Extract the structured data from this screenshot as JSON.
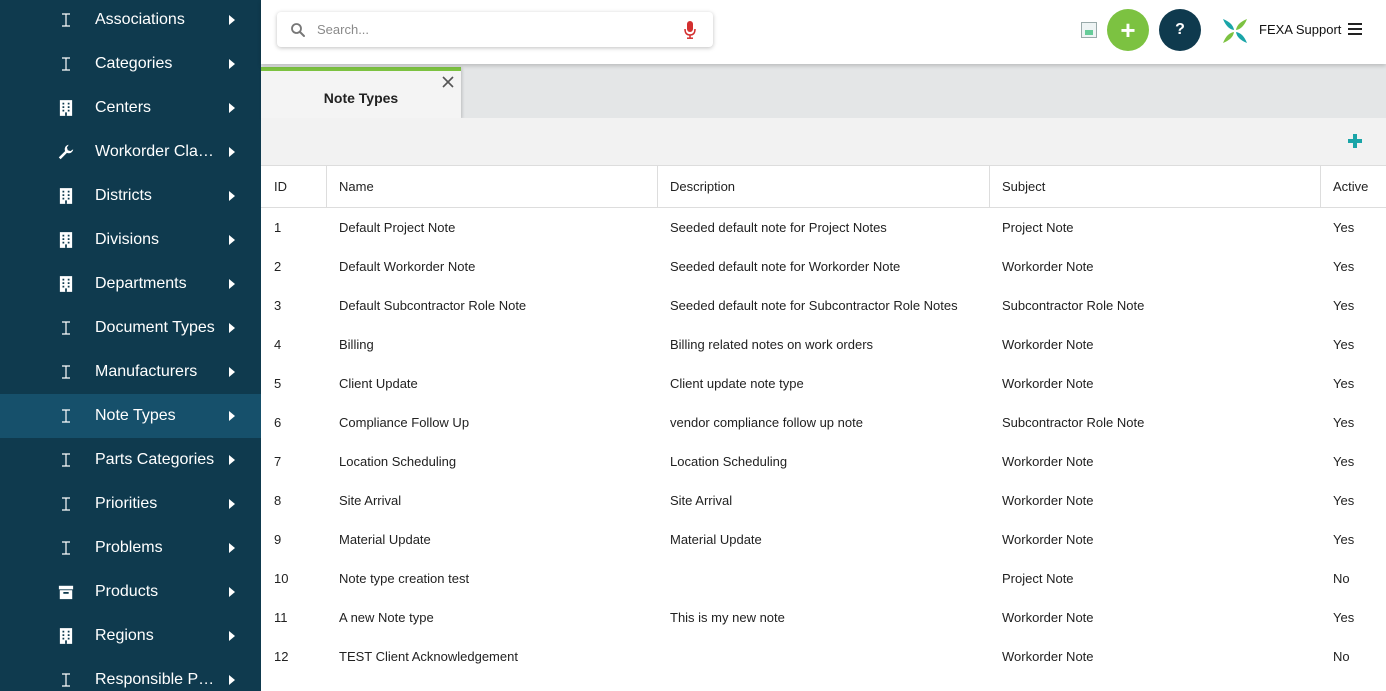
{
  "sidebar": {
    "items": [
      {
        "label": "Associations",
        "icon": "text-cursor-icon"
      },
      {
        "label": "Categories",
        "icon": "text-cursor-icon"
      },
      {
        "label": "Centers",
        "icon": "building-icon"
      },
      {
        "label": "Workorder Clas...",
        "icon": "wrench-icon"
      },
      {
        "label": "Districts",
        "icon": "building-icon"
      },
      {
        "label": "Divisions",
        "icon": "building-icon"
      },
      {
        "label": "Departments",
        "icon": "building-icon"
      },
      {
        "label": "Document Types",
        "icon": "text-cursor-icon"
      },
      {
        "label": "Manufacturers",
        "icon": "text-cursor-icon"
      },
      {
        "label": "Note Types",
        "icon": "text-cursor-icon",
        "active": true
      },
      {
        "label": "Parts Categories",
        "icon": "text-cursor-icon"
      },
      {
        "label": "Priorities",
        "icon": "text-cursor-icon"
      },
      {
        "label": "Problems",
        "icon": "text-cursor-icon"
      },
      {
        "label": "Products",
        "icon": "archive-box-icon"
      },
      {
        "label": "Regions",
        "icon": "building-icon"
      },
      {
        "label": "Responsible Pa...",
        "icon": "text-cursor-icon"
      }
    ]
  },
  "topbar": {
    "search_placeholder": "Search...",
    "add_symbol": "+",
    "help_symbol": "?",
    "user_name": "FEXA Support"
  },
  "tabs": [
    {
      "label": "Note Types"
    }
  ],
  "table": {
    "columns": [
      "ID",
      "Name",
      "Description",
      "Subject",
      "Active"
    ],
    "rows": [
      {
        "id": "1",
        "name": "Default Project Note",
        "description": "Seeded default note for Project Notes",
        "subject": "Project Note",
        "active": "Yes"
      },
      {
        "id": "2",
        "name": "Default Workorder Note",
        "description": "Seeded default note for Workorder Note",
        "subject": "Workorder Note",
        "active": "Yes"
      },
      {
        "id": "3",
        "name": "Default Subcontractor Role Note",
        "description": "Seeded default note for Subcontractor Role Notes",
        "subject": "Subcontractor Role Note",
        "active": "Yes"
      },
      {
        "id": "4",
        "name": "Billing",
        "description": "Billing related notes on work orders",
        "subject": "Workorder Note",
        "active": "Yes"
      },
      {
        "id": "5",
        "name": "Client Update",
        "description": "Client update note type",
        "subject": "Workorder Note",
        "active": "Yes"
      },
      {
        "id": "6",
        "name": "Compliance Follow Up",
        "description": "vendor compliance follow up note",
        "subject": "Subcontractor Role Note",
        "active": "Yes"
      },
      {
        "id": "7",
        "name": "Location Scheduling",
        "description": "Location Scheduling",
        "subject": "Workorder Note",
        "active": "Yes"
      },
      {
        "id": "8",
        "name": "Site Arrival",
        "description": "Site Arrival",
        "subject": "Workorder Note",
        "active": "Yes"
      },
      {
        "id": "9",
        "name": "Material Update",
        "description": "Material Update",
        "subject": "Workorder Note",
        "active": "Yes"
      },
      {
        "id": "10",
        "name": "Note type creation test",
        "description": "",
        "subject": "Project Note",
        "active": "No"
      },
      {
        "id": "11",
        "name": "A new Note type",
        "description": "This is my new note",
        "subject": "Workorder Note",
        "active": "Yes"
      },
      {
        "id": "12",
        "name": "TEST Client Acknowledgement",
        "description": "",
        "subject": "Workorder Note",
        "active": "No"
      }
    ]
  },
  "colors": {
    "sidebar_bg": "#0f3a4e",
    "sidebar_active": "#16506b",
    "accent_green": "#7cc241",
    "accent_teal": "#1aa5a8",
    "mic_red": "#d32f2f"
  }
}
